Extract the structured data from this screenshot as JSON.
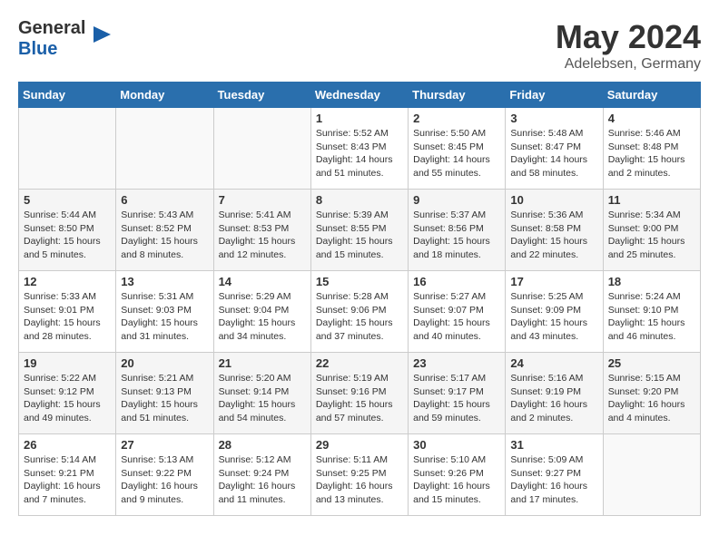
{
  "header": {
    "logo_general": "General",
    "logo_blue": "Blue",
    "month_year": "May 2024",
    "location": "Adelebsen, Germany"
  },
  "days_of_week": [
    "Sunday",
    "Monday",
    "Tuesday",
    "Wednesday",
    "Thursday",
    "Friday",
    "Saturday"
  ],
  "weeks": [
    [
      {
        "day": "",
        "info": ""
      },
      {
        "day": "",
        "info": ""
      },
      {
        "day": "",
        "info": ""
      },
      {
        "day": "1",
        "info": "Sunrise: 5:52 AM\nSunset: 8:43 PM\nDaylight: 14 hours\nand 51 minutes."
      },
      {
        "day": "2",
        "info": "Sunrise: 5:50 AM\nSunset: 8:45 PM\nDaylight: 14 hours\nand 55 minutes."
      },
      {
        "day": "3",
        "info": "Sunrise: 5:48 AM\nSunset: 8:47 PM\nDaylight: 14 hours\nand 58 minutes."
      },
      {
        "day": "4",
        "info": "Sunrise: 5:46 AM\nSunset: 8:48 PM\nDaylight: 15 hours\nand 2 minutes."
      }
    ],
    [
      {
        "day": "5",
        "info": "Sunrise: 5:44 AM\nSunset: 8:50 PM\nDaylight: 15 hours\nand 5 minutes."
      },
      {
        "day": "6",
        "info": "Sunrise: 5:43 AM\nSunset: 8:52 PM\nDaylight: 15 hours\nand 8 minutes."
      },
      {
        "day": "7",
        "info": "Sunrise: 5:41 AM\nSunset: 8:53 PM\nDaylight: 15 hours\nand 12 minutes."
      },
      {
        "day": "8",
        "info": "Sunrise: 5:39 AM\nSunset: 8:55 PM\nDaylight: 15 hours\nand 15 minutes."
      },
      {
        "day": "9",
        "info": "Sunrise: 5:37 AM\nSunset: 8:56 PM\nDaylight: 15 hours\nand 18 minutes."
      },
      {
        "day": "10",
        "info": "Sunrise: 5:36 AM\nSunset: 8:58 PM\nDaylight: 15 hours\nand 22 minutes."
      },
      {
        "day": "11",
        "info": "Sunrise: 5:34 AM\nSunset: 9:00 PM\nDaylight: 15 hours\nand 25 minutes."
      }
    ],
    [
      {
        "day": "12",
        "info": "Sunrise: 5:33 AM\nSunset: 9:01 PM\nDaylight: 15 hours\nand 28 minutes."
      },
      {
        "day": "13",
        "info": "Sunrise: 5:31 AM\nSunset: 9:03 PM\nDaylight: 15 hours\nand 31 minutes."
      },
      {
        "day": "14",
        "info": "Sunrise: 5:29 AM\nSunset: 9:04 PM\nDaylight: 15 hours\nand 34 minutes."
      },
      {
        "day": "15",
        "info": "Sunrise: 5:28 AM\nSunset: 9:06 PM\nDaylight: 15 hours\nand 37 minutes."
      },
      {
        "day": "16",
        "info": "Sunrise: 5:27 AM\nSunset: 9:07 PM\nDaylight: 15 hours\nand 40 minutes."
      },
      {
        "day": "17",
        "info": "Sunrise: 5:25 AM\nSunset: 9:09 PM\nDaylight: 15 hours\nand 43 minutes."
      },
      {
        "day": "18",
        "info": "Sunrise: 5:24 AM\nSunset: 9:10 PM\nDaylight: 15 hours\nand 46 minutes."
      }
    ],
    [
      {
        "day": "19",
        "info": "Sunrise: 5:22 AM\nSunset: 9:12 PM\nDaylight: 15 hours\nand 49 minutes."
      },
      {
        "day": "20",
        "info": "Sunrise: 5:21 AM\nSunset: 9:13 PM\nDaylight: 15 hours\nand 51 minutes."
      },
      {
        "day": "21",
        "info": "Sunrise: 5:20 AM\nSunset: 9:14 PM\nDaylight: 15 hours\nand 54 minutes."
      },
      {
        "day": "22",
        "info": "Sunrise: 5:19 AM\nSunset: 9:16 PM\nDaylight: 15 hours\nand 57 minutes."
      },
      {
        "day": "23",
        "info": "Sunrise: 5:17 AM\nSunset: 9:17 PM\nDaylight: 15 hours\nand 59 minutes."
      },
      {
        "day": "24",
        "info": "Sunrise: 5:16 AM\nSunset: 9:19 PM\nDaylight: 16 hours\nand 2 minutes."
      },
      {
        "day": "25",
        "info": "Sunrise: 5:15 AM\nSunset: 9:20 PM\nDaylight: 16 hours\nand 4 minutes."
      }
    ],
    [
      {
        "day": "26",
        "info": "Sunrise: 5:14 AM\nSunset: 9:21 PM\nDaylight: 16 hours\nand 7 minutes."
      },
      {
        "day": "27",
        "info": "Sunrise: 5:13 AM\nSunset: 9:22 PM\nDaylight: 16 hours\nand 9 minutes."
      },
      {
        "day": "28",
        "info": "Sunrise: 5:12 AM\nSunset: 9:24 PM\nDaylight: 16 hours\nand 11 minutes."
      },
      {
        "day": "29",
        "info": "Sunrise: 5:11 AM\nSunset: 9:25 PM\nDaylight: 16 hours\nand 13 minutes."
      },
      {
        "day": "30",
        "info": "Sunrise: 5:10 AM\nSunset: 9:26 PM\nDaylight: 16 hours\nand 15 minutes."
      },
      {
        "day": "31",
        "info": "Sunrise: 5:09 AM\nSunset: 9:27 PM\nDaylight: 16 hours\nand 17 minutes."
      },
      {
        "day": "",
        "info": ""
      }
    ]
  ]
}
